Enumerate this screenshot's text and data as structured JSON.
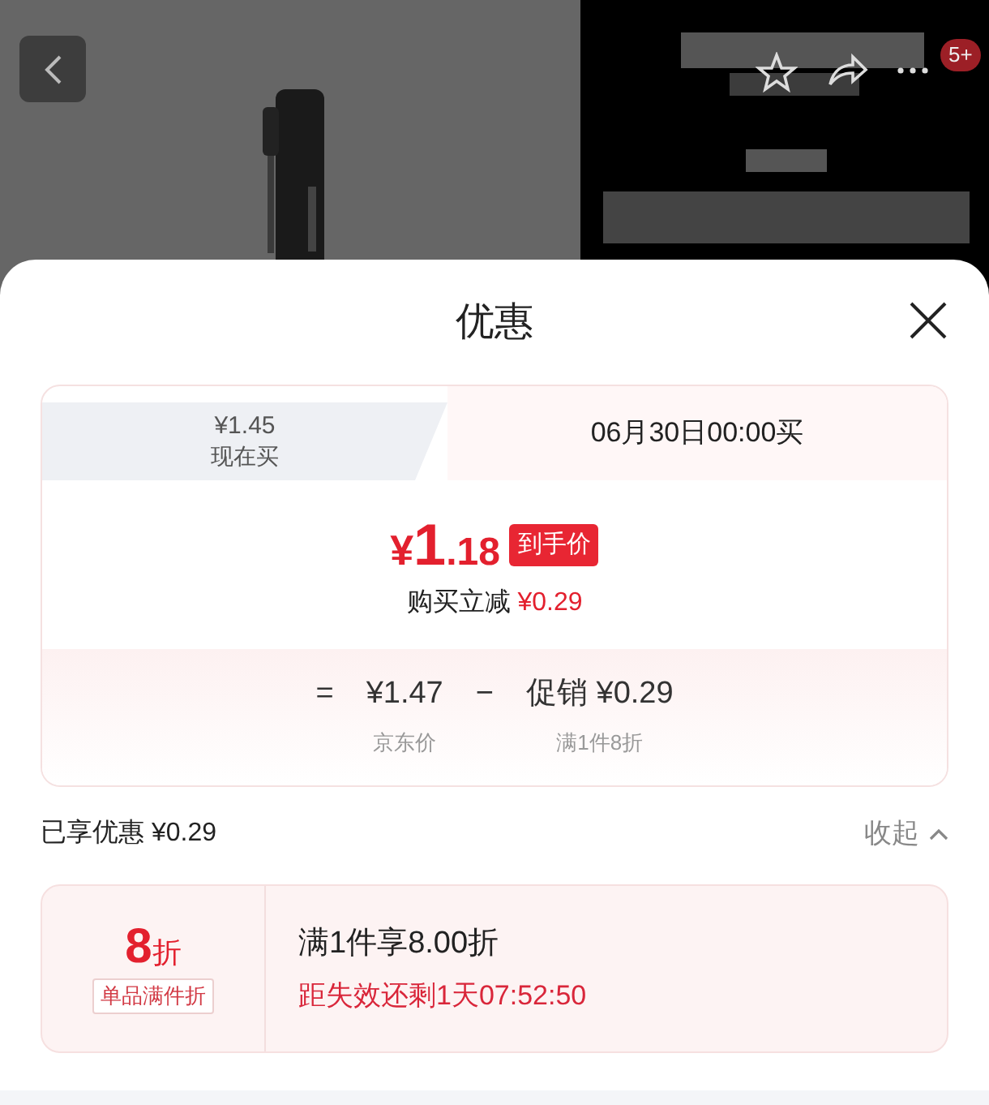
{
  "header": {
    "badge": "5+"
  },
  "sheet": {
    "title": "优惠"
  },
  "tabs": [
    {
      "price": "¥1.45",
      "label": "现在买",
      "selected": false
    },
    {
      "label": "06月30日00:00买",
      "selected": true
    }
  ],
  "final_price": {
    "symbol": "¥",
    "whole": "1",
    "fraction": ".18",
    "tag": "到手价"
  },
  "instant_cut": {
    "label": "购买立减",
    "amount": "¥0.29"
  },
  "breakdown": {
    "equals": "=",
    "base": {
      "value": "¥1.47",
      "caption": "京东价"
    },
    "minus": "−",
    "promo": {
      "label": "促销",
      "value": "¥0.29",
      "caption": "满1件8折"
    }
  },
  "enjoyed": {
    "label": "已享优惠",
    "amount": "¥0.29"
  },
  "collapse": {
    "label": "收起",
    "expanded": true
  },
  "coupons": [
    {
      "discount": "8",
      "unit": "折",
      "type": "单品满件折",
      "title": "满1件享8.00折",
      "countdown": "距失效还剩1天07:52:50"
    }
  ]
}
